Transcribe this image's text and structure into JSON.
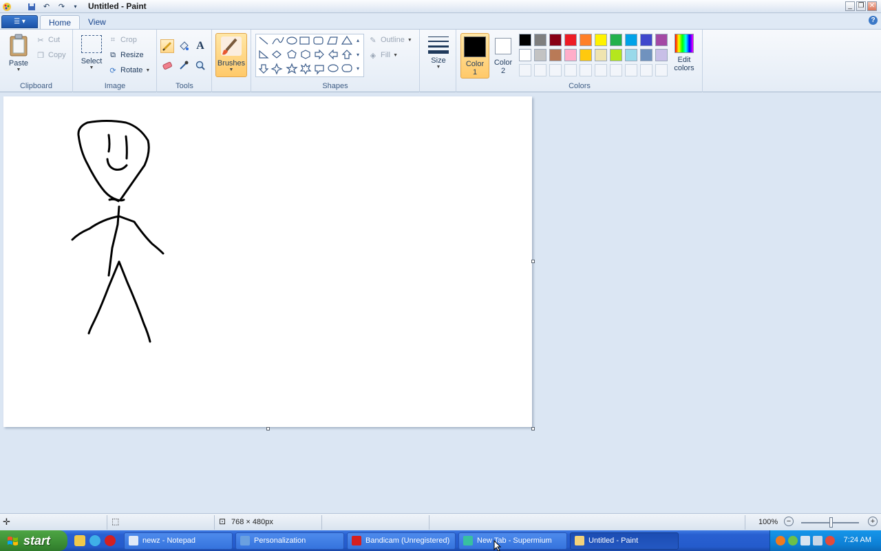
{
  "window": {
    "title": "Untitled - Paint",
    "minimize": "_",
    "restore": "❐",
    "close": "✕"
  },
  "tabs": {
    "app_menu": "☰ ▾",
    "home": "Home",
    "view": "View"
  },
  "ribbon": {
    "clipboard": {
      "label": "Clipboard",
      "paste": "Paste",
      "cut": "Cut",
      "copy": "Copy"
    },
    "image": {
      "label": "Image",
      "select": "Select",
      "crop": "Crop",
      "resize": "Resize",
      "rotate": "Rotate"
    },
    "tools": {
      "label": "Tools"
    },
    "brushes": {
      "label": "Brushes"
    },
    "shapes": {
      "label": "Shapes",
      "outline": "Outline",
      "fill": "Fill"
    },
    "size": {
      "label": "Size"
    },
    "colors": {
      "label": "Colors",
      "color1": "Color 1",
      "color1_line1": "Color",
      "color1_line2": "1",
      "color2_line1": "Color",
      "color2_line2": "2",
      "edit_line1": "Edit",
      "edit_line2": "colors",
      "color1_value": "#000000",
      "color2_value": "#ffffff",
      "palette_row1": [
        "#000000",
        "#7f7f7f",
        "#880015",
        "#ed1c24",
        "#ff7f27",
        "#fff200",
        "#22b14c",
        "#00a2e8",
        "#3f48cc",
        "#a349a4"
      ],
      "palette_row2": [
        "#ffffff",
        "#c3c3c3",
        "#b97a57",
        "#ffaec9",
        "#ffc90e",
        "#efe4b0",
        "#b5e61d",
        "#99d9ea",
        "#7092be",
        "#c8bfe7"
      ]
    }
  },
  "statusbar": {
    "image_size": "768 × 480px",
    "zoom": "100%"
  },
  "taskbar": {
    "start": "start",
    "tasks": [
      {
        "label": "newz - Notepad",
        "color": "#dfe9f7"
      },
      {
        "label": "Personalization",
        "color": "#6aa0e0"
      },
      {
        "label": "Bandicam (Unregistered)",
        "color": "#d61f1f"
      },
      {
        "label": "New Tab - Supermium",
        "color": "#38c0a0"
      },
      {
        "label": "Untitled - Paint",
        "color": "#f3d27a"
      }
    ],
    "clock": "7:24 AM"
  }
}
